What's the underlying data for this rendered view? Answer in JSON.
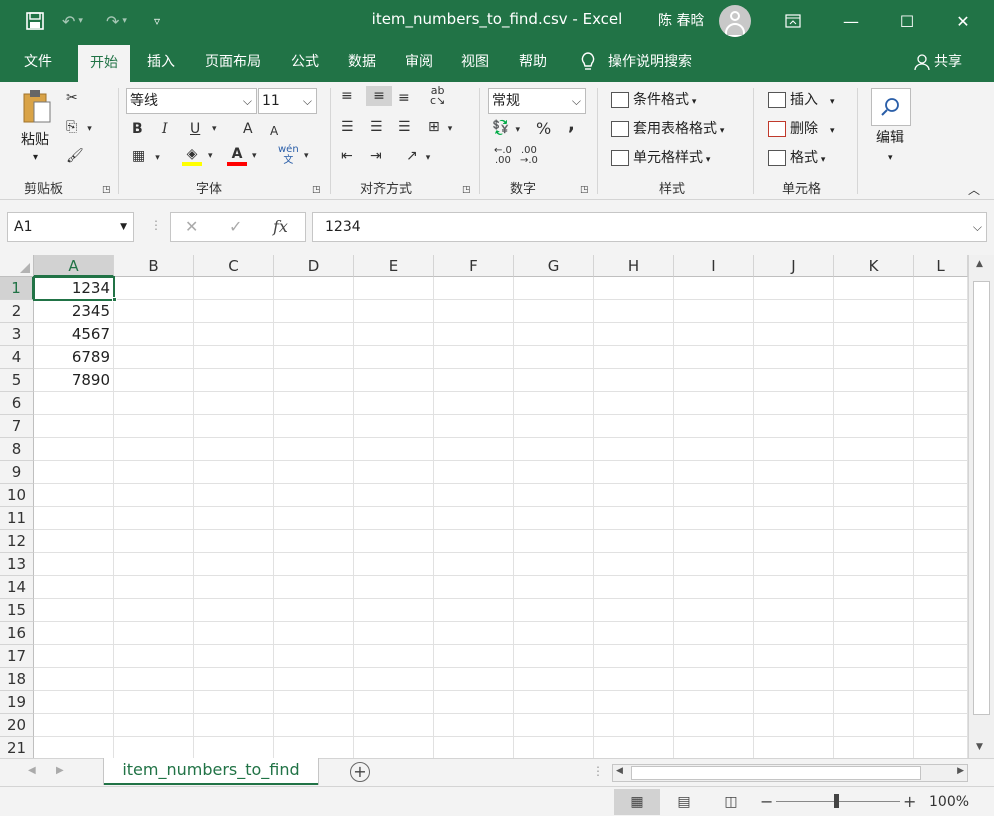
{
  "window": {
    "title": "item_numbers_to_find.csv  -  Excel",
    "user": "陈 春晗",
    "save_icon": "save-icon",
    "undo_icon": "undo-icon",
    "redo_icon": "redo-icon"
  },
  "menu": {
    "items": [
      "文件",
      "开始",
      "插入",
      "页面布局",
      "公式",
      "数据",
      "审阅",
      "视图",
      "帮助"
    ],
    "active": "开始",
    "tell_me": "操作说明搜索",
    "share": "共享"
  },
  "ribbon": {
    "clipboard": {
      "paste": "粘贴",
      "label": "剪贴板"
    },
    "font": {
      "name": "等线",
      "size": "11",
      "label": "字体",
      "bold": "B",
      "italic": "I",
      "underline": "U",
      "grow": "A",
      "shrink": "A",
      "font_color": "A",
      "phonetic": "wén\n文"
    },
    "alignment": {
      "label": "对齐方式"
    },
    "number": {
      "format": "常规",
      "label": "数字",
      "percent": "%",
      "comma": ","
    },
    "styles": {
      "conditional": "条件格式",
      "table": "套用表格格式",
      "cell_styles": "单元格样式",
      "label": "样式"
    },
    "cells": {
      "insert": "插入",
      "delete": "删除",
      "format": "格式",
      "label": "单元格"
    },
    "editing": {
      "label": "编辑"
    }
  },
  "formula_bar": {
    "name_box": "A1",
    "fx": "fx",
    "value": "1234"
  },
  "sheet": {
    "columns": [
      "A",
      "B",
      "C",
      "D",
      "E",
      "F",
      "G",
      "H",
      "I",
      "J",
      "K",
      "L"
    ],
    "rows": [
      "1",
      "2",
      "3",
      "4",
      "5",
      "6",
      "7",
      "8",
      "9",
      "10",
      "11",
      "12",
      "13",
      "14",
      "15",
      "16",
      "17",
      "18",
      "19",
      "20",
      "21"
    ],
    "column_a_values": [
      "1234",
      "2345",
      "4567",
      "6789",
      "7890"
    ],
    "selected_cell": "A1"
  },
  "tabs": {
    "sheet_name": "item_numbers_to_find",
    "add": "+"
  },
  "status": {
    "zoom": "100%",
    "zoom_minus": "−",
    "zoom_plus": "+"
  },
  "colors": {
    "brand": "#217346",
    "highlight": "#ffff00",
    "font_color": "#ff0000"
  }
}
